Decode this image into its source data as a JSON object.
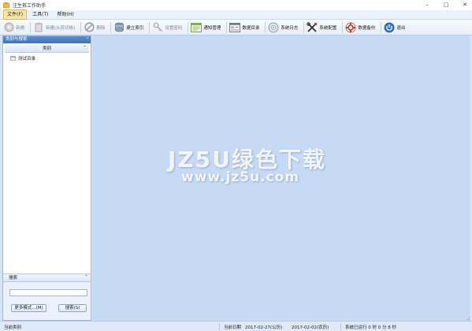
{
  "window": {
    "title": "注生救工作助手",
    "controls": {
      "minimize": "–",
      "maximize": "□",
      "close": "✕"
    }
  },
  "menu": {
    "items": [
      {
        "label": "文件(F)",
        "active": true
      },
      {
        "label": "工具(T)",
        "active": false
      },
      {
        "label": "帮助(H)",
        "active": false
      }
    ]
  },
  "toolbar": {
    "buttons": [
      {
        "label": "新建",
        "icon": "new-icon",
        "disabled": true
      },
      {
        "label": "新建(从剪切板)",
        "icon": "new-from-clipboard-icon",
        "disabled": true
      },
      {
        "label": "删除",
        "icon": "delete-icon",
        "disabled": true
      },
      {
        "label": "建立索引",
        "icon": "build-index-icon",
        "disabled": false
      },
      {
        "label": "设置密码",
        "icon": "set-password-icon",
        "disabled": true
      },
      {
        "label": "通知管理",
        "icon": "notification-icon",
        "disabled": false
      },
      {
        "label": "数据目录",
        "icon": "data-directory-icon",
        "disabled": false
      },
      {
        "label": "系统日志",
        "icon": "system-log-icon",
        "disabled": false
      },
      {
        "label": "系统配置",
        "icon": "system-config-icon",
        "disabled": false
      },
      {
        "label": "数据备份",
        "icon": "data-backup-icon",
        "disabled": false
      },
      {
        "label": "退出",
        "icon": "exit-icon",
        "disabled": false
      }
    ]
  },
  "left_panel": {
    "title": "类别与搜索",
    "pin": "ᵖ",
    "category_header": "类别",
    "collapse_glyph": "ˆ",
    "tree": [
      {
        "label": "测试目录",
        "icon": "folder-icon"
      }
    ],
    "search": {
      "header": "搜索",
      "input_value": "",
      "more_button": "更多模式...(M)",
      "search_button": "搜索(S)"
    }
  },
  "main": {
    "watermark_line1": "JZ5U绿色下载",
    "watermark_line2": "www.jz5u.com"
  },
  "statusbar": {
    "current_category": "当前类别",
    "date_label": "当前日期",
    "date_gregorian": "2017-02-27(公历)",
    "date_lunar": "2017-02-02(农历)",
    "uptime": "系统已运行  0 时 0 分 8 秒"
  },
  "colors": {
    "panel_title": "#4a7cc4",
    "main_bg": "#c6daf5",
    "menu_active": "#fde7a8"
  }
}
